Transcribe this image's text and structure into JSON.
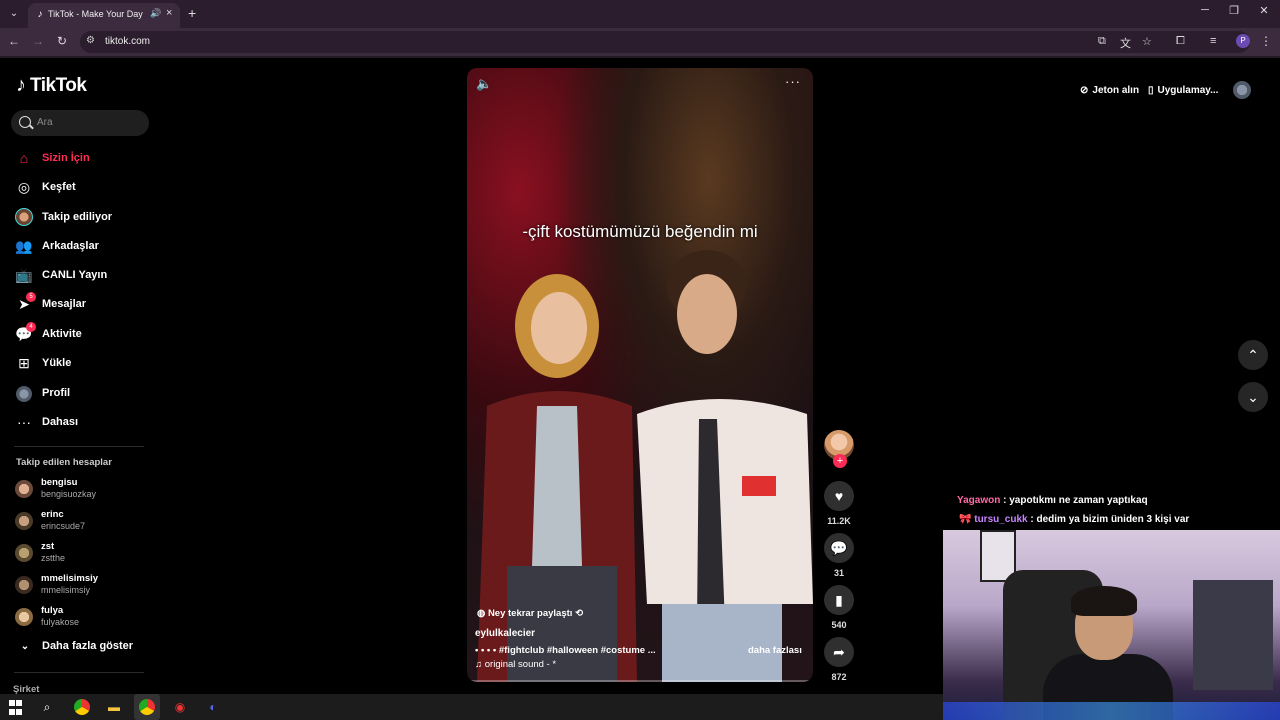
{
  "browser": {
    "tab_title": "TikTok - Make Your Day",
    "url": "tiktok.com",
    "new_tab": "+",
    "win_min": "─",
    "win_max": "❐",
    "win_close": "✕",
    "profile_letter": "P"
  },
  "sidebar": {
    "logo": "TikTok",
    "search_placeholder": "Ara",
    "items": [
      {
        "label": "Sizin İçin",
        "icon": "home-icon"
      },
      {
        "label": "Keşfet",
        "icon": "compass-icon"
      },
      {
        "label": "Takip ediliyor",
        "icon": "following-avatar-icon"
      },
      {
        "label": "Arkadaşlar",
        "icon": "friends-icon"
      },
      {
        "label": "CANLI Yayın",
        "icon": "live-icon"
      },
      {
        "label": "Mesajlar",
        "icon": "messages-icon",
        "badge": "5"
      },
      {
        "label": "Aktivite",
        "icon": "activity-icon",
        "badge": "4"
      },
      {
        "label": "Yükle",
        "icon": "upload-icon"
      },
      {
        "label": "Profil",
        "icon": "profile-avatar-icon"
      },
      {
        "label": "Dahası",
        "icon": "more-dots-icon"
      }
    ],
    "following_title": "Takip edilen hesaplar",
    "following": [
      {
        "name": "bengisu",
        "handle": "bengisuozkay"
      },
      {
        "name": "erinc",
        "handle": "erincsude7"
      },
      {
        "name": "zst",
        "handle": "zstthe"
      },
      {
        "name": "mmelisimsiy",
        "handle": "mmelisimsiy"
      },
      {
        "name": "fulya",
        "handle": "fulyakose"
      }
    ],
    "show_more": "Daha fazla göster",
    "company": "Şirket"
  },
  "topbar": {
    "coins": "Jeton alın",
    "app": "Uygulamay..."
  },
  "video": {
    "overlay_text": "-çift kostümümüzü beğendin mi",
    "repost": "Ney tekrar paylaştı",
    "author": "eylulkalecier",
    "description": "• • • • #fightclub  #halloween  #costume  ...",
    "more": "daha fazlası",
    "sound": "original sound - *"
  },
  "actions": {
    "likes": "11.2K",
    "comments": "31",
    "saves": "540",
    "shares": "872",
    "follow": "+"
  },
  "chat": [
    {
      "user": "Yagawon",
      "message": "yapotıkmı ne zaman yaptıkaq"
    },
    {
      "user": "tursu_cukk",
      "message": "dedim ya bizim üniden 3 kişi var"
    }
  ]
}
